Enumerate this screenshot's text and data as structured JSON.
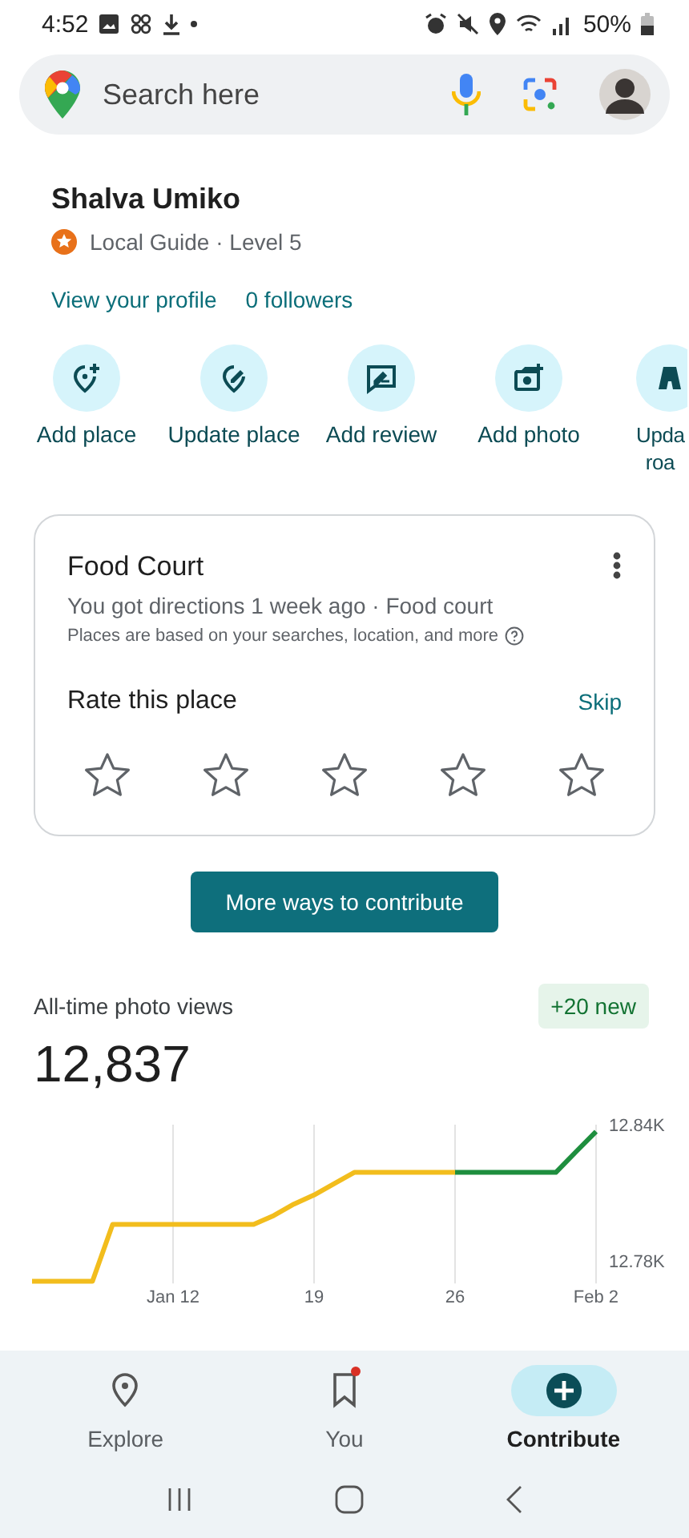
{
  "status_bar": {
    "time": "4:52",
    "battery": "50%"
  },
  "search": {
    "placeholder": "Search here"
  },
  "profile": {
    "name": "Shalva Umiko",
    "guide": "Local Guide · Level 5",
    "links": [
      "View your profile",
      "0 followers"
    ]
  },
  "actions": [
    {
      "kind": "add-place",
      "label": "Add place"
    },
    {
      "kind": "update-place",
      "label": "Update place"
    },
    {
      "kind": "add-review",
      "label": "Add review"
    },
    {
      "kind": "add-photo",
      "label": "Add photo"
    },
    {
      "kind": "update-road",
      "label": "Upda roa"
    }
  ],
  "card": {
    "title": "Food Court",
    "subtitle": "You got directions 1 week ago · Food court",
    "note": "Places are based on your searches, location, and more",
    "rate_label": "Rate this place",
    "skip": "Skip",
    "stars": 0
  },
  "more_button": "More ways to contribute",
  "stats": {
    "label": "All-time photo views",
    "badge": "+20 new",
    "value": "12,837",
    "chart_data": {
      "type": "line",
      "categories": [
        null,
        null,
        null,
        null,
        null,
        null,
        null,
        "Jan 12",
        null,
        null,
        null,
        null,
        null,
        null,
        "19",
        null,
        null,
        null,
        null,
        null,
        null,
        "26",
        null,
        null,
        null,
        null,
        null,
        null,
        "Feb 2"
      ],
      "series": [
        {
          "color": "#f2bd1d",
          "values": [
            12771,
            12771,
            12771,
            12771,
            12796,
            12796,
            12796,
            12796,
            12796,
            12796,
            12796,
            12796,
            12800,
            12805,
            12809,
            12814,
            12819,
            12819,
            12819,
            12819,
            12819,
            12819,
            null,
            null,
            null,
            null,
            null,
            null,
            null
          ]
        },
        {
          "color": "#1e8e3e",
          "values": [
            null,
            null,
            null,
            null,
            null,
            null,
            null,
            null,
            null,
            null,
            null,
            null,
            null,
            null,
            null,
            null,
            null,
            null,
            null,
            null,
            null,
            12819,
            12819,
            12819,
            12819,
            12819,
            12819,
            12828,
            12837
          ]
        }
      ],
      "ylim": [
        12770,
        12840
      ],
      "grid": true,
      "yticks": [
        {
          "value": 12780,
          "label": "12.78K"
        },
        {
          "value": 12840,
          "label": "12.84K"
        }
      ]
    }
  },
  "nav": [
    {
      "kind": "explore",
      "label": "Explore",
      "selected": false,
      "badge": false
    },
    {
      "kind": "you",
      "label": "You",
      "selected": false,
      "badge": true
    },
    {
      "kind": "contribute",
      "label": "Contribute",
      "selected": true,
      "badge": false
    }
  ]
}
